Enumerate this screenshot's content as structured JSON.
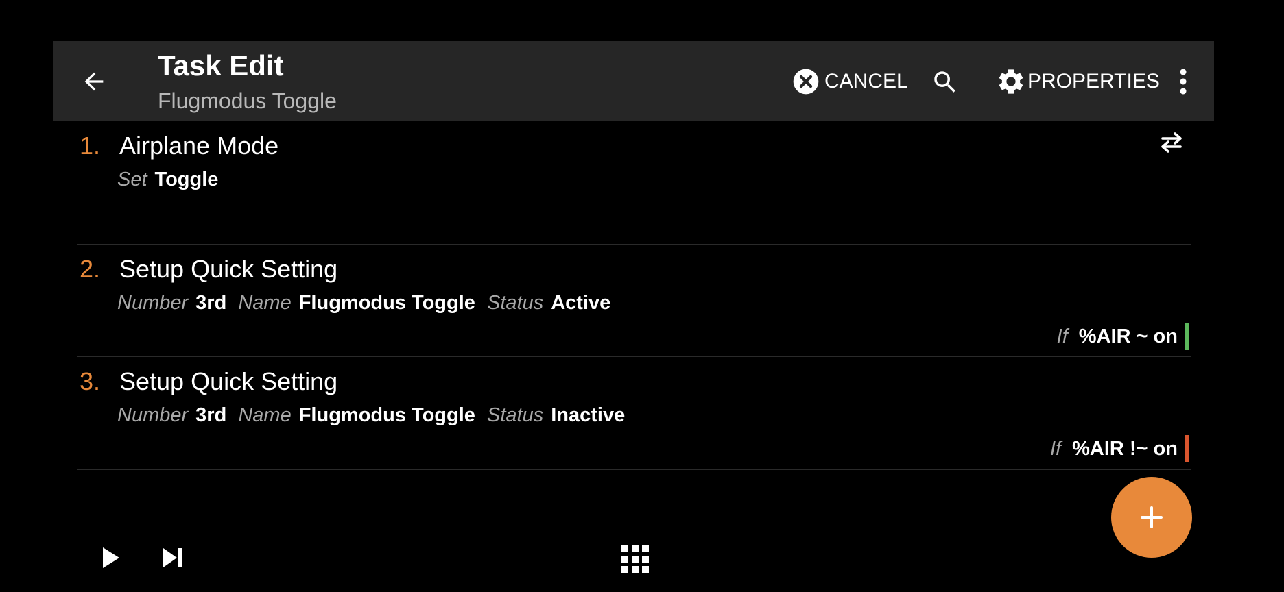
{
  "colors": {
    "background": "#000000",
    "appbar": "#262626",
    "accent": "#e8893a",
    "muted_text": "#a8a8a8",
    "condition_true": "#5cb85c",
    "condition_false": "#d9552e"
  },
  "header": {
    "title": "Task Edit",
    "subtitle": "Flugmodus Toggle",
    "back_icon": "arrow-left-icon",
    "cancel_label": "CANCEL",
    "cancel_icon": "close-circle-icon",
    "search_icon": "search-icon",
    "properties_label": "PROPERTIES",
    "properties_icon": "gear-icon",
    "more_icon": "more-vertical-icon"
  },
  "actions": [
    {
      "number": "1.",
      "name": "Airplane Mode",
      "params": [
        {
          "label": "Set",
          "value": "Toggle"
        }
      ],
      "icon": "swap-horizontal-icon"
    },
    {
      "number": "2.",
      "name": "Setup Quick Setting",
      "params": [
        {
          "label": "Number",
          "value": "3rd"
        },
        {
          "label": "Name",
          "value": "Flugmodus Toggle"
        },
        {
          "label": "Status",
          "value": "Active"
        }
      ],
      "condition": {
        "label": "If",
        "expression": "%AIR ~ on",
        "state": "true"
      }
    },
    {
      "number": "3.",
      "name": "Setup Quick Setting",
      "params": [
        {
          "label": "Number",
          "value": "3rd"
        },
        {
          "label": "Name",
          "value": "Flugmodus Toggle"
        },
        {
          "label": "Status",
          "value": "Inactive"
        }
      ],
      "condition": {
        "label": "If",
        "expression": "%AIR !~ on",
        "state": "false"
      }
    }
  ],
  "bottombar": {
    "play_icon": "play-icon",
    "step_icon": "skip-next-icon",
    "grid_icon": "grid-icon"
  },
  "fab": {
    "icon": "plus-icon"
  }
}
